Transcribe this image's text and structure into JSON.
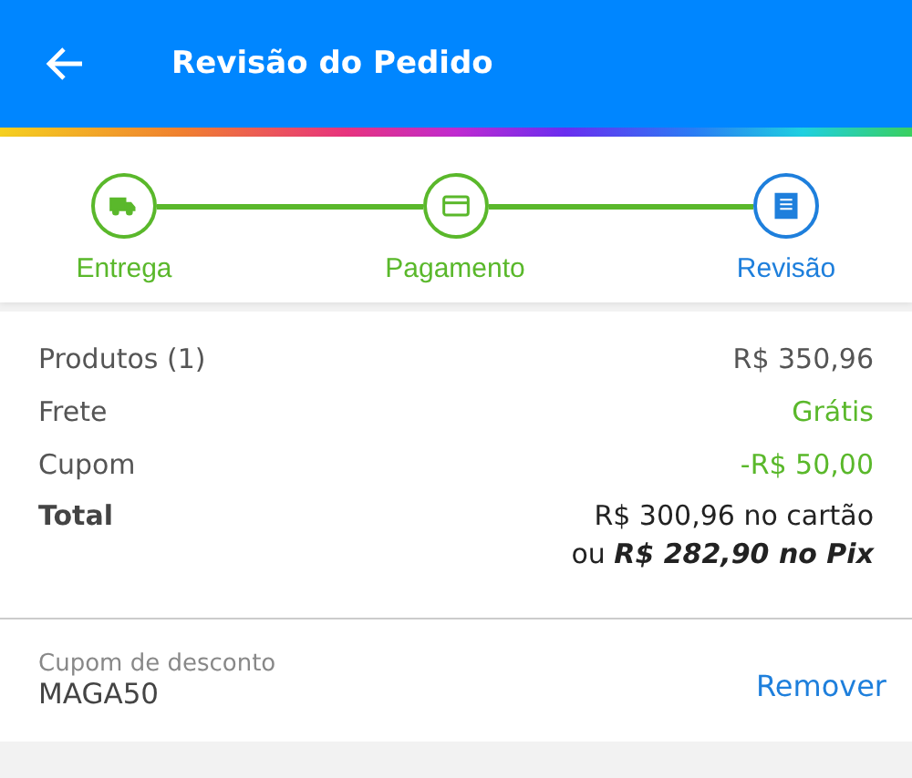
{
  "header": {
    "title": "Revisão do Pedido"
  },
  "steps": [
    {
      "label": "Entrega",
      "selected": false,
      "kind": "delivery"
    },
    {
      "label": "Pagamento",
      "selected": false,
      "kind": "payment"
    },
    {
      "label": "Revisão",
      "selected": true,
      "kind": "review"
    }
  ],
  "summary": [
    {
      "label": "Produtos (1)",
      "value": "R$ 350,96",
      "highlight": false
    },
    {
      "label": "Frete",
      "value": "Grátis",
      "highlight": true
    },
    {
      "label": "Cupom",
      "value": "-R$ 50,00",
      "highlight": true
    }
  ],
  "total": {
    "label": "Total",
    "lines": [
      "R$ 300,96 no cartão",
      "ou *R$ 282,90 no Pix*"
    ]
  },
  "coupon": {
    "label": "Cupom de desconto",
    "code": "MAGA50",
    "action": "Remover"
  }
}
